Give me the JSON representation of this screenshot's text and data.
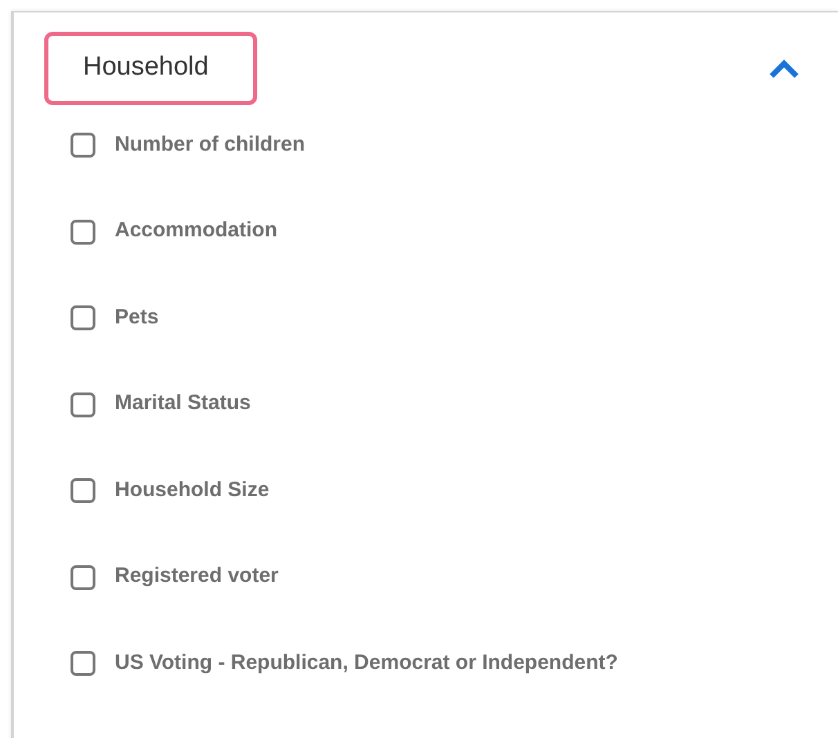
{
  "section": {
    "title": "Household",
    "highlighted": true,
    "expanded": true
  },
  "options": [
    {
      "label": "Number of children",
      "checked": false
    },
    {
      "label": "Accommodation",
      "checked": false
    },
    {
      "label": "Pets",
      "checked": false
    },
    {
      "label": "Marital Status",
      "checked": false
    },
    {
      "label": "Household Size",
      "checked": false
    },
    {
      "label": "Registered voter",
      "checked": false
    },
    {
      "label": "US Voting - Republican, Democrat or Independent?",
      "checked": false
    }
  ]
}
